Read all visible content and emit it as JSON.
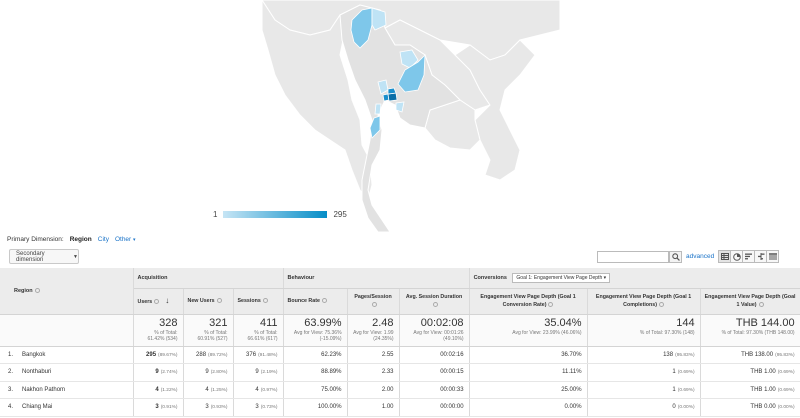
{
  "map": {
    "legend_min": "1",
    "legend_max": "295",
    "colors": {
      "land": "#e8e8e8",
      "border": "#ffffff",
      "low": "#bfe3f5",
      "mid": "#7ec7ea",
      "high": "#1b8fcc",
      "max": "#0b6fa8",
      "water": "#ffffff"
    }
  },
  "primary_dimension": {
    "label": "Primary Dimension:",
    "active": "Region",
    "options": [
      "City",
      "Other"
    ]
  },
  "toolbar": {
    "secondary_dimension": "Secondary dimension",
    "search_placeholder": "",
    "advanced": "advanced",
    "view_icons": [
      "table-view-icon",
      "pie-view-icon",
      "bar-view-icon",
      "comparison-view-icon",
      "pivot-view-icon"
    ]
  },
  "table": {
    "groups": {
      "region": "Region",
      "acquisition": "Acquisition",
      "behaviour": "Behaviour",
      "conversions": "Conversions",
      "goal_select": "Goal 1: Engagement View Page Depth"
    },
    "columns": [
      "Users",
      "New Users",
      "Sessions",
      "Bounce Rate",
      "Pages/Session",
      "Avg. Session Duration",
      "Engagement View Page Depth (Goal 1 Conversion Rate)",
      "Engagement View Page Depth (Goal 1 Completions)",
      "Engagement View Page Depth (Goal 1 Value)"
    ],
    "totals": [
      {
        "value": "328",
        "sub1": "% of Total:",
        "sub2": "61.42% (534)"
      },
      {
        "value": "321",
        "sub1": "% of Total:",
        "sub2": "60.91% (527)"
      },
      {
        "value": "411",
        "sub1": "% of Total:",
        "sub2": "66.61% (617)"
      },
      {
        "value": "63.99%",
        "sub1": "Avg for View: 75.36%",
        "sub2": "(-15.09%)"
      },
      {
        "value": "2.48",
        "sub1": "Avg for View: 1.99",
        "sub2": "(24.35%)"
      },
      {
        "value": "00:02:08",
        "sub1": "Avg for View: 00:01:26",
        "sub2": "(49.10%)"
      },
      {
        "value": "35.04%",
        "sub1": "Avg for View: 23.99% (46.06%)",
        "sub2": ""
      },
      {
        "value": "144",
        "sub1": "% of Total: 97.30% (148)",
        "sub2": ""
      },
      {
        "value": "THB 144.00",
        "sub1": "% of Total: 97.30% (THB 148.00)",
        "sub2": ""
      }
    ],
    "rows": [
      {
        "idx": "1.",
        "region": "Bangkok",
        "users": "295",
        "users_pct": "(89.67%)",
        "new_users": "288",
        "new_users_pct": "(89.72%)",
        "sessions": "376",
        "sessions_pct": "(91.48%)",
        "bounce": "62.23%",
        "pages": "2.55",
        "duration": "00:02:16",
        "conv": "36.70%",
        "completions": "138",
        "completions_pct": "(95.83%)",
        "value": "THB 138.00",
        "value_pct": "(95.83%)"
      },
      {
        "idx": "2.",
        "region": "Nonthaburi",
        "users": "9",
        "users_pct": "(2.74%)",
        "new_users": "9",
        "new_users_pct": "(2.80%)",
        "sessions": "9",
        "sessions_pct": "(2.19%)",
        "bounce": "88.89%",
        "pages": "2.33",
        "duration": "00:00:15",
        "conv": "11.11%",
        "completions": "1",
        "completions_pct": "(0.69%)",
        "value": "THB 1.00",
        "value_pct": "(0.69%)"
      },
      {
        "idx": "3.",
        "region": "Nakhon Pathom",
        "users": "4",
        "users_pct": "(1.22%)",
        "new_users": "4",
        "new_users_pct": "(1.25%)",
        "sessions": "4",
        "sessions_pct": "(0.97%)",
        "bounce": "75.00%",
        "pages": "2.00",
        "duration": "00:00:33",
        "conv": "25.00%",
        "completions": "1",
        "completions_pct": "(0.69%)",
        "value": "THB 1.00",
        "value_pct": "(0.69%)"
      },
      {
        "idx": "4.",
        "region": "Chiang Mai",
        "users": "3",
        "users_pct": "(0.91%)",
        "new_users": "3",
        "new_users_pct": "(0.93%)",
        "sessions": "3",
        "sessions_pct": "(0.73%)",
        "bounce": "100.00%",
        "pages": "1.00",
        "duration": "00:00:00",
        "conv": "0.00%",
        "completions": "0",
        "completions_pct": "(0.00%)",
        "value": "THB 0.00",
        "value_pct": "(0.00%)"
      }
    ]
  }
}
